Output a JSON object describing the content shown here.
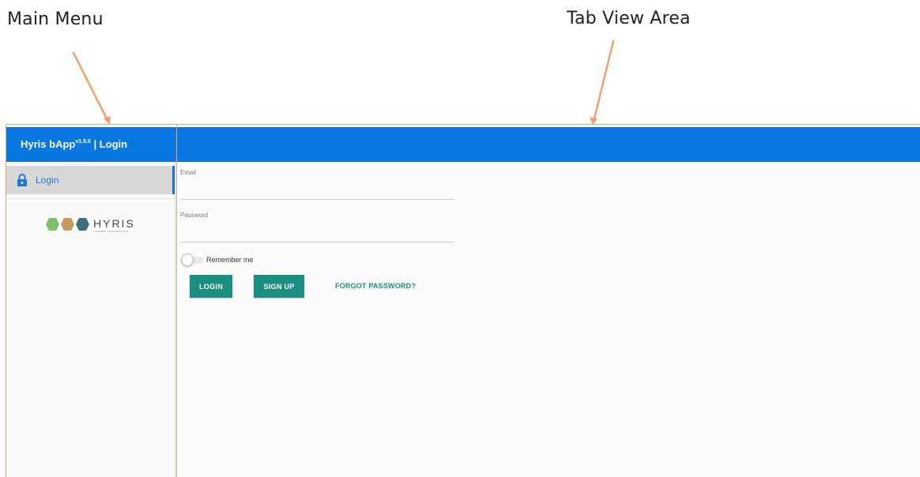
{
  "annotations": {
    "main_menu": "Main Menu",
    "tab_view_area": "Tab View Area"
  },
  "colors": {
    "topbar": "#0a77e0",
    "accent_teal": "#1a8f81",
    "nav_active": "#1f78d1",
    "annotation_arrow": "#f0a070"
  },
  "header": {
    "app_name": "Hyris bApp",
    "version": "v1.5.0",
    "section": "| Login"
  },
  "sidebar": {
    "items": [
      {
        "label": "Login",
        "icon": "lock-icon",
        "active": true
      }
    ],
    "logo": {
      "text": "HYRIS",
      "subtext": "GLOBAL DIAGNOSTICS"
    }
  },
  "login_form": {
    "email_label": "Email",
    "email_value": "",
    "password_label": "Password",
    "password_value": "",
    "remember_label": "Remember me",
    "remember_checked": false,
    "login_button": "LOGIN",
    "signup_button": "SIGN UP",
    "forgot_link": "FORGOT PASSWORD?"
  }
}
